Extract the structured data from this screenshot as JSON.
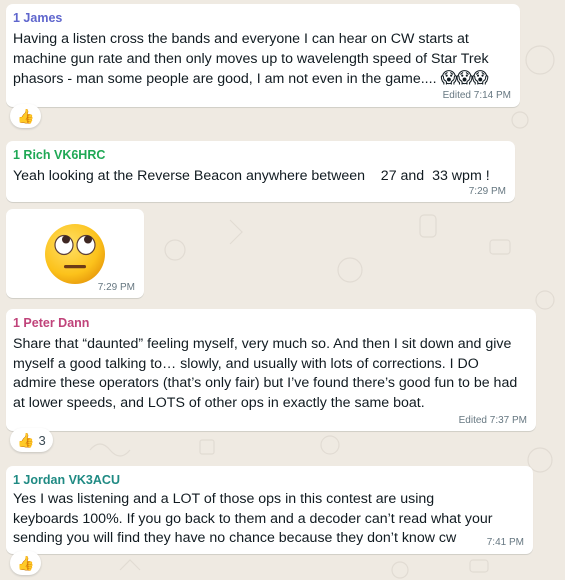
{
  "messages": [
    {
      "sender": "1 James",
      "sender_color": "#5f66cd",
      "text": "Having a listen cross the bands and everyone I can hear on CW starts at machine gun rate and then only moves up to wavelength speed of Star Trek phasors - man some people are good, I am not even in the game.... ",
      "trailing_emoji": "😱😱😱",
      "time": "Edited 7:14 PM",
      "reaction": {
        "emoji": "👍",
        "count": ""
      }
    },
    {
      "sender": "1 Rich VK6HRC",
      "sender_color": "#1fa855",
      "text": "Yeah looking at the Reverse Beacon anywhere between    27 and  33 wpm !",
      "time": "7:29 PM"
    },
    {
      "emoji_icon": "face-with-rolling-eyes-emoji",
      "time": "7:29 PM"
    },
    {
      "sender": "1 Peter Dann",
      "sender_color": "#c0437a",
      "text": "Share that “daunted” feeling myself, very much so. And then I sit down and give myself a good talking to… slowly, and usually with lots of corrections. I DO admire these operators (that’s only fair) but I’ve found there’s good fun to be had at lower speeds, and LOTS of other ops in exactly the same boat.",
      "time": "Edited 7:37 PM",
      "reaction": {
        "emoji": "👍",
        "count": "3"
      }
    },
    {
      "sender": "1 Jordan VK3ACU",
      "sender_color": "#1f8a83",
      "text": "Yes I was listening and a LOT of those ops in this contest are using keyboards 100%. If you go back to them and a decoder can’t read what your sending you will find they have no chance because they don’t know cw",
      "time": "7:41 PM",
      "reaction": {
        "emoji": "👍",
        "count": ""
      }
    }
  ]
}
